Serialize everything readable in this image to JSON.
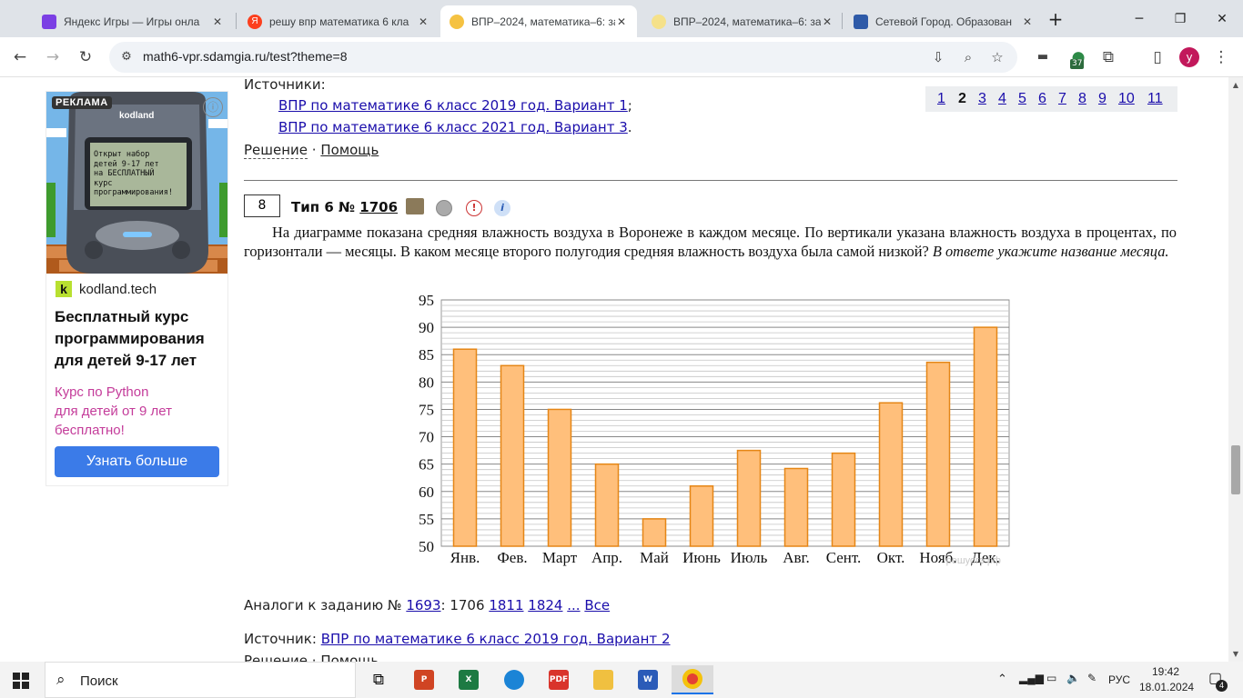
{
  "browser": {
    "tabs": [
      {
        "title": "Яндекс Игры — Игры онла",
        "favicon_color": "#7b3fe4",
        "active": false
      },
      {
        "title": "решу впр математика 6 кла",
        "favicon_color": "#fc3f1d",
        "active": false
      },
      {
        "title": "ВПР–2024, математика–6: за",
        "favicon_color": "#f5c242",
        "active": true
      },
      {
        "title": "ВПР–2024, математика–6: за",
        "favicon_color": "#f5c242",
        "active": false
      },
      {
        "title": "Сетевой Город. Образован",
        "favicon_color": "#2e5aa8",
        "active": false
      }
    ],
    "new_tab": "+",
    "url": "math6-vpr.sdamgia.ru/test?theme=8",
    "extensions_badge": "37",
    "profile_letter": "у"
  },
  "ad": {
    "tag": "РЕКЛАМА",
    "brand": "kodland",
    "phone_screen": "Открыт набор\nдетей 9-17 лет\nна БЕСПЛАТНЫЙ\nкурс\nпрограммирования!",
    "domain_letter": "k",
    "domain": "kodland.tech",
    "headline": "Бесплатный курс программирования для детей 9-17 лет",
    "subtext": "Курс по Python\nдля детей от 9 лет\nбесплатно!",
    "button": "Узнать больше"
  },
  "prev_task": {
    "sources_label": "Источники:",
    "sources": [
      "ВПР по математике 6 класс 2019 год. Вариант 1",
      "ВПР по математике 6 класс 2021 год. Вариант 3"
    ],
    "solution_link": "Решение",
    "sep": "·",
    "help_link": "Помощь"
  },
  "pager": {
    "pages": [
      "1",
      "2",
      "3",
      "4",
      "5",
      "6",
      "7",
      "8",
      "9",
      "10",
      "11"
    ],
    "current": "2"
  },
  "task": {
    "number": "8",
    "type_label": "Тип 6 №",
    "id": "1706",
    "text_main": "На диаграмме показана средняя влажность воздуха в Воронеже в каждом месяце. По вертикали указана влажность воздуха в процентах, по горизонтали — месяцы. В каком месяце второго полугодия средняя влажность воздуха была самой низкой?",
    "text_italic": "В ответе укажите название месяца.",
    "analogs_label": "Аналоги к заданию №",
    "analogs_first": "1693",
    "analogs_mid": "1706",
    "analogs": [
      "1811",
      "1824"
    ],
    "analogs_more": "...",
    "analogs_all": "Все",
    "source_label": "Источник:",
    "source_link": "ВПР по математике 6 класс 2019 год. Вариант 2",
    "cut_text": "Решение · Помощь"
  },
  "chart_data": {
    "type": "bar",
    "categories": [
      "Янв.",
      "Фев.",
      "Март",
      "Апр.",
      "Май",
      "Июнь",
      "Июль",
      "Авг.",
      "Сент.",
      "Окт.",
      "Нояб.",
      "Дек."
    ],
    "values": [
      86,
      83,
      75,
      65,
      55,
      61,
      67.5,
      64.2,
      67,
      76.2,
      83.6,
      90
    ],
    "ylim": [
      50,
      95
    ],
    "yticks": [
      50,
      55,
      60,
      65,
      70,
      75,
      80,
      85,
      90,
      95
    ],
    "grid": true,
    "watermark": "решуогэ.рф",
    "title": "",
    "xlabel": "",
    "ylabel": ""
  },
  "taskbar": {
    "search_placeholder": "Поиск",
    "lang": "РУС",
    "time": "19:42",
    "date": "18.01.2024",
    "notifications": "4"
  }
}
